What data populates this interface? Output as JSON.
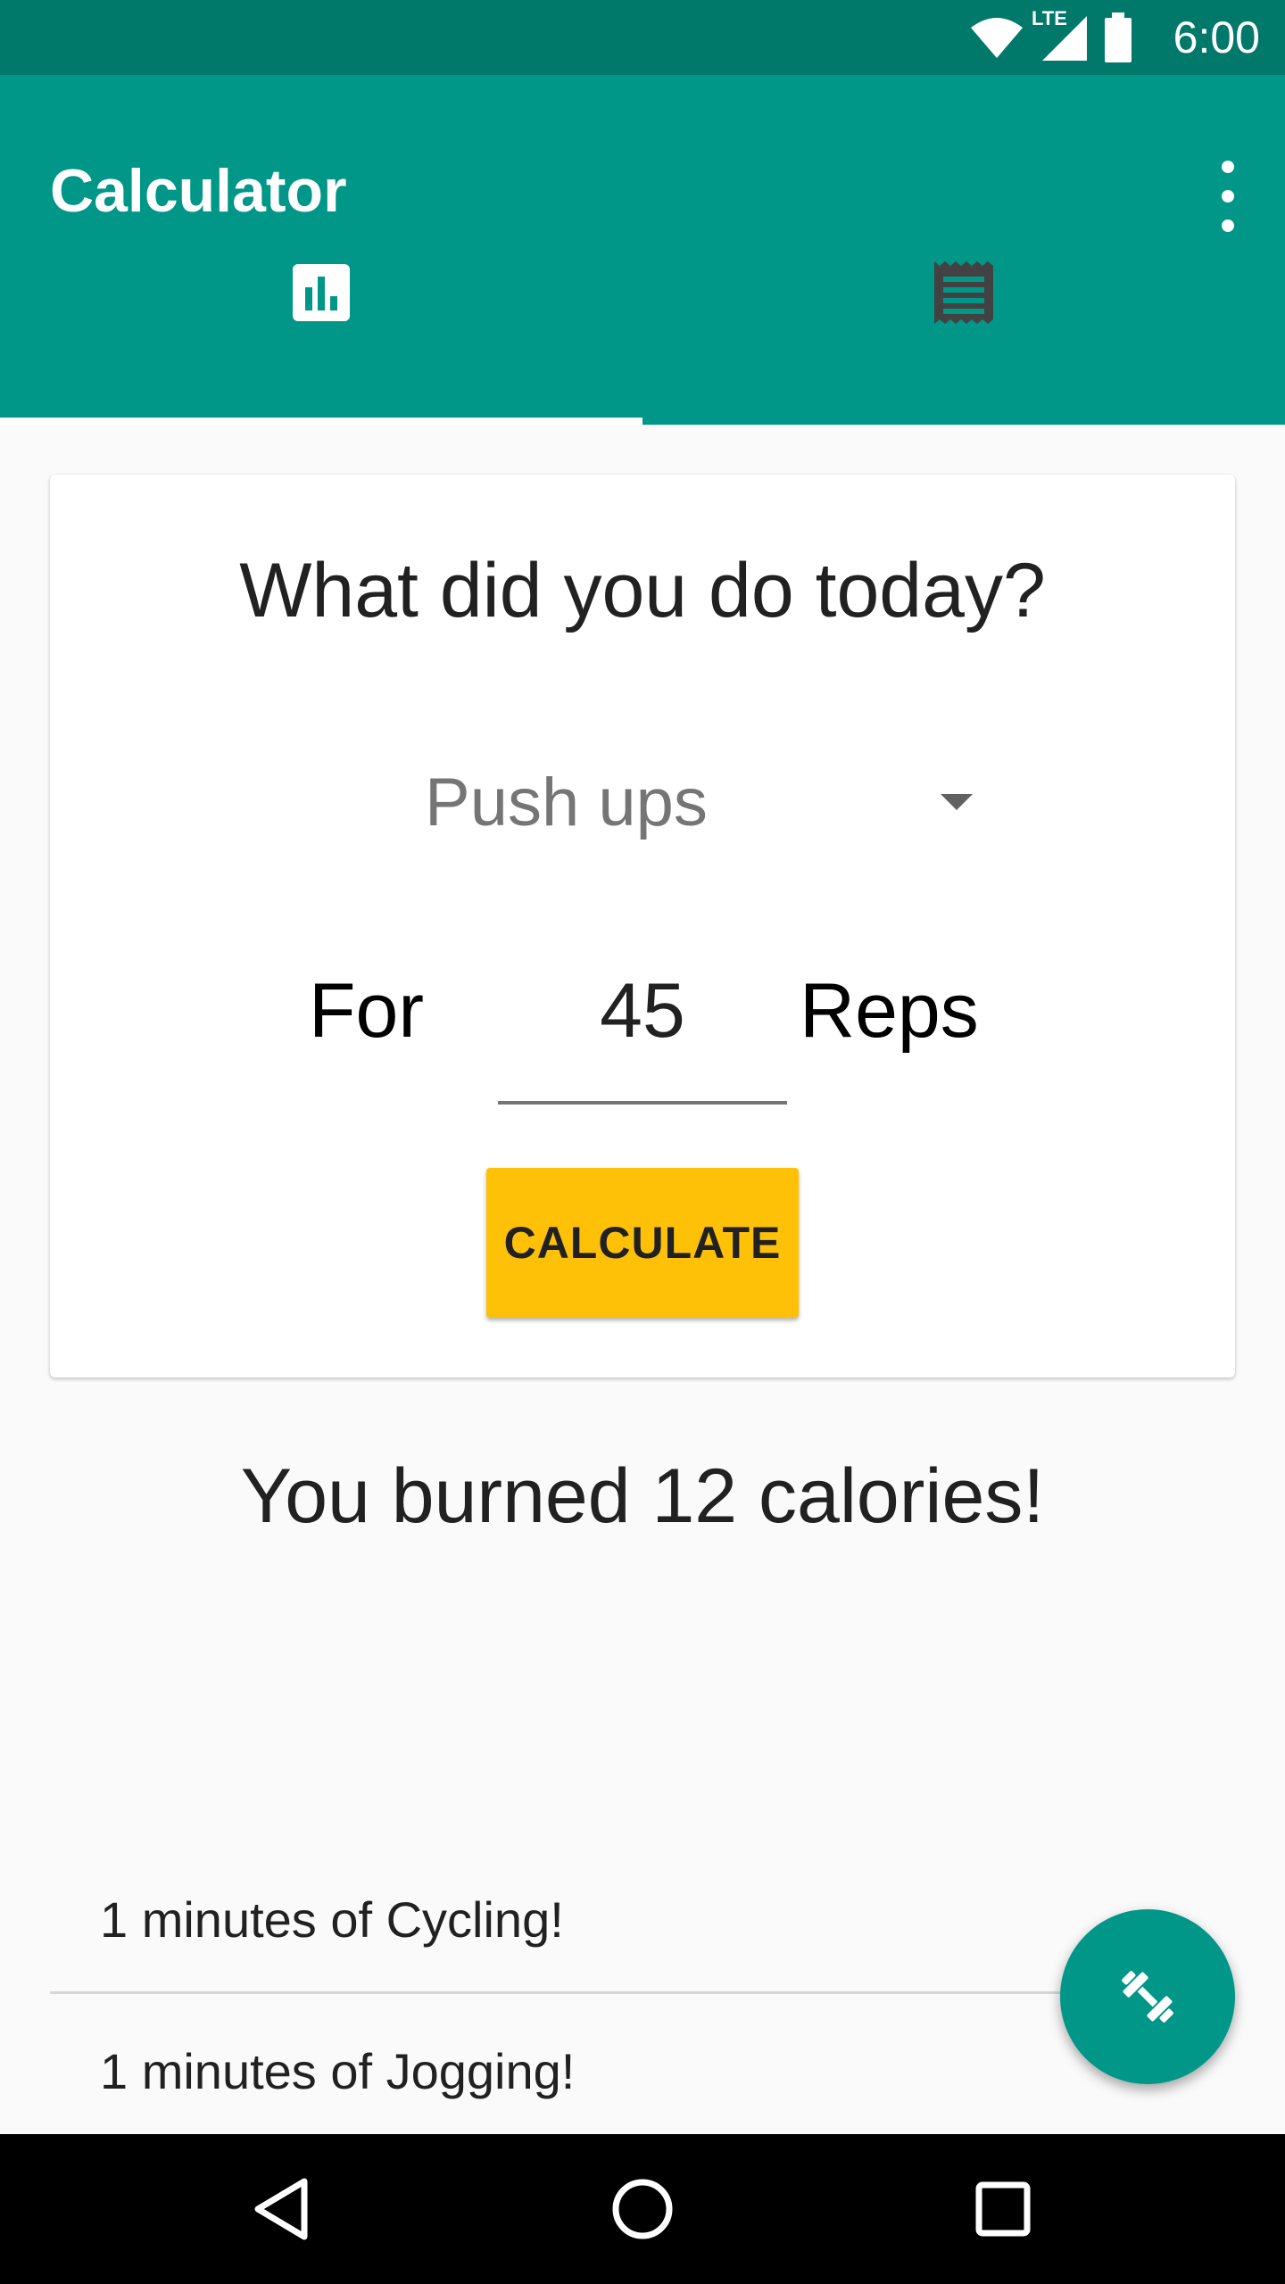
{
  "status_bar": {
    "time": "6:00",
    "network_label": "LTE",
    "icons": [
      "wifi-icon",
      "cell-signal-icon",
      "battery-icon"
    ]
  },
  "app_bar": {
    "title": "Calculator",
    "overflow_icon": "more-vert-icon",
    "tabs": [
      {
        "icon": "bar-chart-icon",
        "selected": true
      },
      {
        "icon": "receipt-list-icon",
        "selected": false
      }
    ]
  },
  "card": {
    "question": "What did you do today?",
    "activity_selected": "Push ups",
    "for_label": "For",
    "reps_value": "45",
    "unit_label": "Reps",
    "calculate_label": "CALCULATE"
  },
  "result": "You burned 12 calories!",
  "history": [
    "1 minutes of Cycling!",
    "1 minutes of Jogging!"
  ],
  "fab": {
    "icon": "fitness-dumbbell-icon"
  },
  "nav_bar": {
    "icons": [
      "back-icon",
      "home-icon",
      "recents-icon"
    ]
  },
  "colors": {
    "primary": "#009688",
    "primary_dark": "#00796b",
    "accent": "#ffc107",
    "background": "#fafafa"
  }
}
